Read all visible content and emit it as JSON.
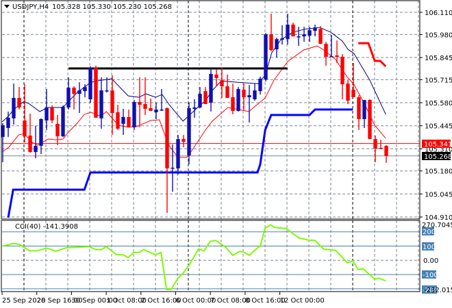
{
  "header": {
    "symbol": "USDJPY,H4",
    "ohlc": "105.328 105.330 105.230 105.268",
    "menu_icon": "triangle-down-icon"
  },
  "colors": {
    "bull": "#1010b0",
    "bear": "#ff0000",
    "ma_upper": "#000080",
    "ma_lower": "#ff0000",
    "support_line": "#0000ff",
    "resistance_line": "#000000",
    "stop_line": "#ff0000",
    "cci": "#7cfc00",
    "cci_levels": "#4682b4",
    "bid_line": "#ff0000",
    "last_line": "#778899",
    "grid": "#7a8590"
  },
  "price_axis": {
    "labels": [
      "106.110",
      "105.980",
      "105.845",
      "105.715",
      "105.580",
      "105.445",
      "105.310",
      "105.180",
      "105.045",
      "104.910"
    ],
    "bid_label": "105.341",
    "last_label": "105.268"
  },
  "time_axis": {
    "labels": [
      "25 Sep 2020",
      "28 Sep 16:00",
      "30 Sep 00:00",
      "1 Oct 08:00",
      "2 Oct 16:00",
      "6 Oct 00:00",
      "7 Oct 08:00",
      "8 Oct 16:00",
      "12 Oct 00:00"
    ]
  },
  "cci_panel": {
    "title": "CCI(40) -141.3908",
    "max_label": "270.7045",
    "min_label": "-232.0152",
    "levels": [
      "200",
      "100",
      "0.00",
      "-100",
      "-200"
    ]
  },
  "chart_data": {
    "type": "candlestick",
    "symbol": "USDJPY",
    "timeframe": "H4",
    "ylim": [
      104.91,
      106.11
    ],
    "bid": 105.341,
    "last": 105.268,
    "candles": [
      [
        105.379,
        105.46,
        105.231,
        105.448
      ],
      [
        105.432,
        105.528,
        105.379,
        105.492
      ],
      [
        105.488,
        105.692,
        105.452,
        105.608
      ],
      [
        105.608,
        105.672,
        105.54,
        105.552
      ],
      [
        105.476,
        105.688,
        105.347,
        105.383
      ],
      [
        105.387,
        105.516,
        105.287,
        105.291
      ],
      [
        105.291,
        105.444,
        105.255,
        105.327
      ],
      [
        105.327,
        105.488,
        105.279,
        105.484
      ],
      [
        105.476,
        105.66,
        105.42,
        105.552
      ],
      [
        105.552,
        105.564,
        105.46,
        105.476
      ],
      [
        105.456,
        105.508,
        105.331,
        105.383
      ],
      [
        105.383,
        105.564,
        105.379,
        105.556
      ],
      [
        105.552,
        105.729,
        105.54,
        105.668
      ],
      [
        105.668,
        105.676,
        105.54,
        105.632
      ],
      [
        105.632,
        105.7,
        105.52,
        105.652
      ],
      [
        105.648,
        105.688,
        105.612,
        105.672
      ],
      [
        105.6,
        105.793,
        105.58,
        105.785
      ],
      [
        105.785,
        105.797,
        105.492,
        105.492
      ],
      [
        105.488,
        105.729,
        105.428,
        105.652
      ],
      [
        105.648,
        105.729,
        105.64,
        105.652
      ],
      [
        105.652,
        105.741,
        105.391,
        105.52
      ],
      [
        105.524,
        105.568,
        105.42,
        105.428
      ],
      [
        105.456,
        105.544,
        105.391,
        105.496
      ],
      [
        105.496,
        105.54,
        105.436,
        105.436
      ],
      [
        105.436,
        105.596,
        105.42,
        105.584
      ],
      [
        105.584,
        105.729,
        105.436,
        105.568
      ],
      [
        105.572,
        105.729,
        105.508,
        105.544
      ],
      [
        105.548,
        105.604,
        105.532,
        105.532
      ],
      [
        105.524,
        105.58,
        105.484,
        105.54
      ],
      [
        105.536,
        105.66,
        105.532,
        105.54
      ],
      [
        105.548,
        105.552,
        104.934,
        105.195
      ],
      [
        105.195,
        105.335,
        105.058,
        105.199
      ],
      [
        105.195,
        105.391,
        105.159,
        105.367
      ],
      [
        105.367,
        105.391,
        105.319,
        105.351
      ],
      [
        105.271,
        105.58,
        105.219,
        105.548
      ],
      [
        105.544,
        105.6,
        105.492,
        105.552
      ],
      [
        105.552,
        105.672,
        105.548,
        105.632
      ],
      [
        105.648,
        105.672,
        105.572,
        105.572
      ],
      [
        105.58,
        105.781,
        105.528,
        105.749
      ],
      [
        105.745,
        105.777,
        105.68,
        105.725
      ],
      [
        105.712,
        105.785,
        105.608,
        105.676
      ],
      [
        105.676,
        105.745,
        105.608,
        105.608
      ],
      [
        105.612,
        105.692,
        105.512,
        105.532
      ],
      [
        105.532,
        105.672,
        105.528,
        105.66
      ],
      [
        105.656,
        105.692,
        105.532,
        105.612
      ],
      [
        105.612,
        105.684,
        105.464,
        105.624
      ],
      [
        105.6,
        105.692,
        105.592,
        105.652
      ],
      [
        105.648,
        105.733,
        105.628,
        105.721
      ],
      [
        105.716,
        105.989,
        105.704,
        105.981
      ],
      [
        105.981,
        106.102,
        105.881,
        105.889
      ],
      [
        105.893,
        105.961,
        105.845,
        105.953
      ],
      [
        105.949,
        106.034,
        105.921,
        105.957
      ],
      [
        105.953,
        106.102,
        105.921,
        106.038
      ],
      [
        106.038,
        106.05,
        105.969,
        105.969
      ],
      [
        105.965,
        106.025,
        105.913,
        105.969
      ],
      [
        105.969,
        106.025,
        105.937,
        105.981
      ],
      [
        105.973,
        106.025,
        105.937,
        106.005
      ],
      [
        106.001,
        106.038,
        105.969,
        106.021
      ],
      [
        106.013,
        106.029,
        105.925,
        105.925
      ],
      [
        105.925,
        105.937,
        105.797,
        105.849
      ],
      [
        105.849,
        105.977,
        105.849,
        105.853
      ],
      [
        105.857,
        105.945,
        105.813,
        105.849
      ],
      [
        105.849,
        105.865,
        105.6,
        105.688
      ],
      [
        105.692,
        105.712,
        105.572,
        105.592
      ],
      [
        105.656,
        105.813,
        105.612,
        105.612
      ],
      [
        105.612,
        105.624,
        105.42,
        105.484
      ],
      [
        105.484,
        105.596,
        105.432,
        105.596
      ],
      [
        105.596,
        105.6,
        105.367,
        105.367
      ],
      [
        105.367,
        105.387,
        105.231,
        105.311
      ],
      [
        105.315,
        105.363,
        105.307,
        105.311
      ],
      [
        105.327,
        105.331,
        105.227,
        105.267
      ]
    ],
    "ma_upper": [
      [
        -0.1,
        105.468
      ],
      [
        1,
        105.5
      ],
      [
        2,
        105.54
      ],
      [
        3.9,
        105.588
      ],
      [
        4.9,
        105.572
      ],
      [
        6.75,
        105.528
      ],
      [
        8.25,
        105.552
      ],
      [
        11,
        105.552
      ],
      [
        12,
        105.588
      ],
      [
        13.6,
        105.64
      ],
      [
        16.1,
        105.7
      ],
      [
        17.9,
        105.712
      ],
      [
        19.9,
        105.72
      ],
      [
        22.9,
        105.62
      ],
      [
        24.9,
        105.612
      ],
      [
        26.1,
        105.632
      ],
      [
        27.9,
        105.612
      ],
      [
        29.1,
        105.628
      ],
      [
        30.4,
        105.568
      ],
      [
        32.9,
        105.472
      ],
      [
        36.1,
        105.568
      ],
      [
        37,
        105.592
      ],
      [
        38.25,
        105.652
      ],
      [
        39.9,
        105.708
      ],
      [
        42.9,
        105.7
      ],
      [
        46.6,
        105.692
      ],
      [
        47.9,
        105.741
      ],
      [
        49.1,
        105.873
      ],
      [
        50.75,
        105.949
      ],
      [
        52.9,
        105.993
      ],
      [
        55.4,
        106.013
      ],
      [
        57.9,
        106.021
      ],
      [
        59.9,
        105.993
      ],
      [
        62,
        105.941
      ],
      [
        63,
        105.893
      ],
      [
        64.1,
        105.869
      ],
      [
        67,
        105.712
      ],
      [
        69.9,
        105.512
      ]
    ],
    "ma_lower": [
      [
        -0.1,
        105.291
      ],
      [
        1.1,
        105.319
      ],
      [
        2.9,
        105.391
      ],
      [
        3.9,
        105.399
      ],
      [
        5.4,
        105.347
      ],
      [
        6.4,
        105.331
      ],
      [
        8.25,
        105.367
      ],
      [
        9.9,
        105.363
      ],
      [
        11,
        105.367
      ],
      [
        12,
        105.408
      ],
      [
        13.6,
        105.46
      ],
      [
        14.9,
        105.512
      ],
      [
        16.1,
        105.524
      ],
      [
        17.9,
        105.5
      ],
      [
        18.9,
        105.528
      ],
      [
        19.9,
        105.492
      ],
      [
        21.1,
        105.448
      ],
      [
        22.9,
        105.436
      ],
      [
        24.5,
        105.44
      ],
      [
        27,
        105.476
      ],
      [
        28.6,
        105.48
      ],
      [
        29.5,
        105.399
      ],
      [
        30.4,
        105.327
      ],
      [
        32,
        105.259
      ],
      [
        33.6,
        105.259
      ],
      [
        34.5,
        105.299
      ],
      [
        37,
        105.42
      ],
      [
        38.25,
        105.472
      ],
      [
        41.1,
        105.552
      ],
      [
        44.9,
        105.528
      ],
      [
        47.9,
        105.608
      ],
      [
        49.5,
        105.712
      ],
      [
        52,
        105.821
      ],
      [
        54.9,
        105.889
      ],
      [
        57.4,
        105.913
      ],
      [
        58.6,
        105.889
      ],
      [
        60.75,
        105.833
      ],
      [
        62.9,
        105.729
      ],
      [
        64.1,
        105.688
      ],
      [
        66.1,
        105.568
      ],
      [
        67.9,
        105.448
      ],
      [
        69.9,
        105.371
      ]
    ],
    "support_line": [
      [
        1,
        104.906
      ],
      [
        1.9,
        105.07
      ],
      [
        14.9,
        105.07
      ],
      [
        16,
        105.171
      ],
      [
        46.5,
        105.171
      ],
      [
        47,
        105.219
      ],
      [
        47.9,
        105.42
      ],
      [
        49,
        105.508
      ],
      [
        56,
        105.508
      ],
      [
        57,
        105.54
      ],
      [
        63.9,
        105.54
      ]
    ],
    "resistance_line": [
      [
        12,
        105.781
      ],
      [
        52,
        105.781
      ]
    ],
    "stop_line": [
      [
        64.9,
        105.929
      ],
      [
        66.75,
        105.929
      ],
      [
        67.9,
        105.825
      ],
      [
        68.9,
        105.825
      ],
      [
        69.9,
        105.793
      ]
    ],
    "cci": {
      "ylim": [
        -232.0152,
        270.7045
      ],
      "levels": [
        200,
        100,
        0,
        -100,
        -200
      ],
      "points": [
        [
          -0.1,
          99
        ],
        [
          2,
          118
        ],
        [
          3,
          112
        ],
        [
          4.9,
          67
        ],
        [
          6.4,
          67
        ],
        [
          8,
          86
        ],
        [
          9.7,
          64
        ],
        [
          11.6,
          88
        ],
        [
          15.75,
          96
        ],
        [
          17,
          75
        ],
        [
          18,
          75
        ],
        [
          18.9,
          96
        ],
        [
          20.75,
          40
        ],
        [
          22,
          38
        ],
        [
          22.9,
          19
        ],
        [
          23.9,
          56
        ],
        [
          24.9,
          56
        ],
        [
          25.75,
          75
        ],
        [
          27.9,
          38
        ],
        [
          28.9,
          56
        ],
        [
          29.9,
          -205
        ],
        [
          30.75,
          -205
        ],
        [
          32,
          -125
        ],
        [
          32.9,
          -93
        ],
        [
          34.1,
          -29
        ],
        [
          35.75,
          80
        ],
        [
          36.75,
          67
        ],
        [
          37.9,
          134
        ],
        [
          38.9,
          139
        ],
        [
          40.75,
          90
        ],
        [
          42,
          35
        ],
        [
          43.25,
          62
        ],
        [
          43.9,
          59
        ],
        [
          45,
          35
        ],
        [
          46.6,
          91
        ],
        [
          47,
          99
        ],
        [
          47.9,
          227
        ],
        [
          48.9,
          248
        ],
        [
          49.75,
          230
        ],
        [
          51.75,
          224
        ],
        [
          54,
          158
        ],
        [
          55.75,
          142
        ],
        [
          57,
          139
        ],
        [
          58.6,
          78
        ],
        [
          60.75,
          70
        ],
        [
          62.9,
          -18
        ],
        [
          63.9,
          -5
        ],
        [
          64.9,
          -66
        ],
        [
          65.75,
          -58
        ],
        [
          67.9,
          -133
        ],
        [
          68.6,
          -125
        ],
        [
          69.9,
          -144
        ]
      ]
    }
  }
}
